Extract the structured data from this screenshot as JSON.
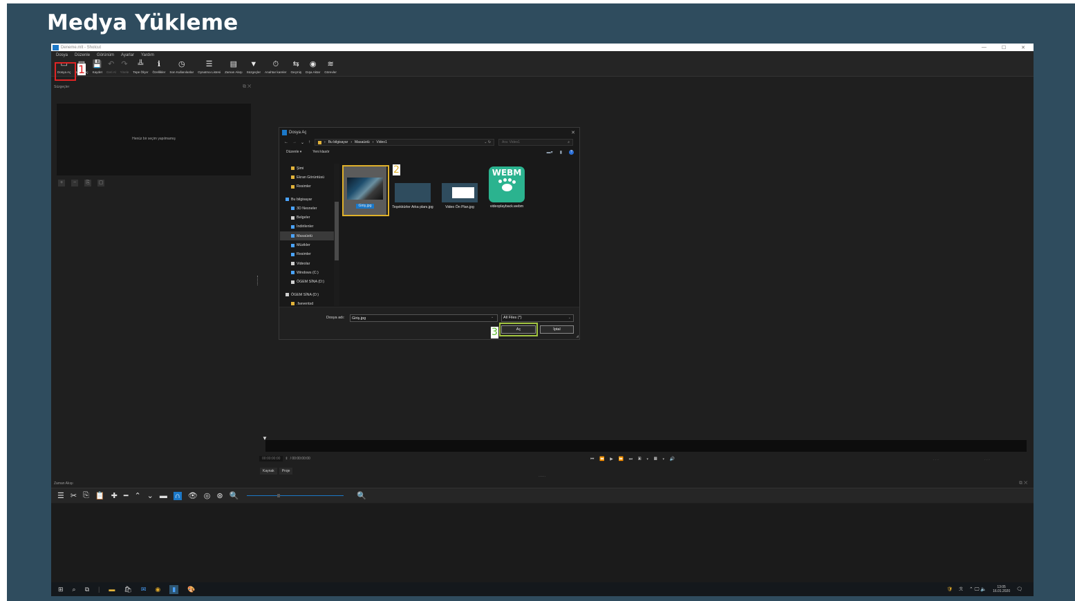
{
  "slide": {
    "title": "Medya Yükleme"
  },
  "window": {
    "title": "Deneme.mlt - Shotcut"
  },
  "menu": [
    "Dosya",
    "Düzenle",
    "Görünüm",
    "Ayarlar",
    "Yardım"
  ],
  "toolbar": [
    {
      "icon": "open-file-icon",
      "glyph": "▭",
      "label": "Dosya Aç",
      "enabled": true
    },
    {
      "icon": "open-other-icon",
      "glyph": "▤",
      "label": "Başka Aç",
      "enabled": true
    },
    {
      "icon": "save-icon",
      "glyph": "💾",
      "label": "Kaydet",
      "enabled": true
    },
    {
      "icon": "undo-icon",
      "glyph": "↶",
      "label": "Geri Al",
      "enabled": false
    },
    {
      "icon": "redo-icon",
      "glyph": "↷",
      "label": "Yinele",
      "enabled": false
    },
    {
      "icon": "peak-meter-icon",
      "glyph": "╩",
      "label": "Tepe Ölçer",
      "enabled": true
    },
    {
      "icon": "properties-icon",
      "glyph": "ℹ",
      "label": "Özellikler",
      "enabled": true
    },
    {
      "icon": "recent-icon",
      "glyph": "◷",
      "label": "Son Kullanılanlar",
      "enabled": true
    },
    {
      "icon": "playlist-icon",
      "glyph": "☰",
      "label": "Oynatma Listesi",
      "enabled": true
    },
    {
      "icon": "timeline-icon",
      "glyph": "▤",
      "label": "Zaman Akışı",
      "enabled": true
    },
    {
      "icon": "filters-icon",
      "glyph": "▼",
      "label": "Süzgeçler",
      "enabled": true
    },
    {
      "icon": "keyframes-icon",
      "glyph": "⏱",
      "label": "Anahtar kareler",
      "enabled": true
    },
    {
      "icon": "history-icon",
      "glyph": "⇆",
      "label": "Geçmiş",
      "enabled": true
    },
    {
      "icon": "export-icon",
      "glyph": "◉",
      "label": "Dışa Aktar",
      "enabled": true
    },
    {
      "icon": "jobs-icon",
      "glyph": "≋",
      "label": "Görevler",
      "enabled": true
    }
  ],
  "filters_panel": {
    "title": "Süzgeçler",
    "empty_text": "Henüz bir seçim yapılmamış"
  },
  "player": {
    "timecode_current": "00:00:00:00",
    "timecode_total": "/ 00:00:00:00",
    "tabs": [
      "Kaynak",
      "Proje"
    ]
  },
  "timeline": {
    "title": "Zaman Akışı"
  },
  "taskbar": {
    "time": "13:05",
    "date": "16.01.2020"
  },
  "dialog": {
    "title": "Dosya Aç",
    "path": [
      "Bu bilgisayar",
      "Masaüstü",
      "Video1"
    ],
    "search_placeholder": "Ara: Video1",
    "organize": "Düzenle ▾",
    "new_folder": "Yeni klasör",
    "nav_items": [
      {
        "label": "Şimi",
        "icon": "folder-icon",
        "color": "#e2b33a",
        "indent": 2
      },
      {
        "label": "Ekran Görüntüsü",
        "icon": "folder-icon",
        "color": "#e2b33a",
        "indent": 2
      },
      {
        "label": "Resimler",
        "icon": "folder-icon",
        "color": "#e2b33a",
        "indent": 2
      },
      {
        "label": "",
        "icon": "",
        "color": "",
        "indent": 0
      },
      {
        "label": "Bu bilgisayar",
        "icon": "computer-icon",
        "color": "#4aa3ff",
        "indent": 1
      },
      {
        "label": "3D Nesneler",
        "icon": "cube-icon",
        "color": "#4aa3ff",
        "indent": 2
      },
      {
        "label": "Belgeler",
        "icon": "document-icon",
        "color": "#cfcfcf",
        "indent": 2
      },
      {
        "label": "İndirilenler",
        "icon": "download-icon",
        "color": "#4aa3ff",
        "indent": 2
      },
      {
        "label": "Masaüstü",
        "icon": "desktop-icon",
        "color": "#4aa3ff",
        "indent": 2,
        "selected": true
      },
      {
        "label": "Müzikler",
        "icon": "music-icon",
        "color": "#4aa3ff",
        "indent": 2
      },
      {
        "label": "Resimler",
        "icon": "pictures-icon",
        "color": "#4aa3ff",
        "indent": 2
      },
      {
        "label": "Videolar",
        "icon": "video-icon",
        "color": "#cfcfcf",
        "indent": 2
      },
      {
        "label": "Windows (C:)",
        "icon": "drive-icon",
        "color": "#4aa3ff",
        "indent": 2
      },
      {
        "label": "ÖGEM SİNA (D:)",
        "icon": "drive-icon",
        "color": "#cfcfcf",
        "indent": 2
      },
      {
        "label": "",
        "icon": "",
        "color": "",
        "indent": 0
      },
      {
        "label": "ÖGEM SİNA (D:)",
        "icon": "drive-icon",
        "color": "#cfcfcf",
        "indent": 1
      },
      {
        "label": ".fseventsd",
        "icon": "folder-icon",
        "color": "#e2b33a",
        "indent": 2
      }
    ],
    "files": {
      "giris": "Giriş.jpg",
      "tesekkur": "Teşekkürler Arka planı.jpg",
      "video_on": "Video Ön Plan.jpg",
      "webm_badge": "WEBM",
      "webm": "videoplayback.webm"
    },
    "filename_label": "Dosya adı:",
    "filename_value": "Giriş.jpg",
    "file_type": "All Files (*)",
    "open_label": "Aç",
    "cancel_label": "İptal"
  },
  "markers": {
    "one": "1",
    "two": "2",
    "three": "3"
  },
  "colors": {
    "slide_bg": "#2f4c5e",
    "accent_blue": "#1b78c8",
    "marker_red": "#e02424",
    "marker_yellow": "#e0b12a",
    "marker_green": "#a4c640"
  }
}
